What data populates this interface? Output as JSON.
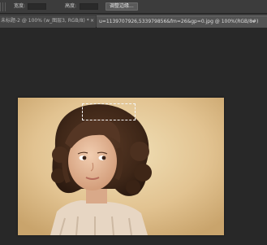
{
  "options_bar": {
    "width_label": "宽度:",
    "height_label": "高度:",
    "refine_edge_button": "调整边缘..."
  },
  "tabs": [
    {
      "label": "未标题-2 @ 100% (w_图层3, RGB/8) *",
      "active": false
    },
    {
      "label": "u=1139707926,533979856&fm=26&gp=0.jpg @ 100%(RGB/8#)",
      "active": true
    }
  ],
  "close_glyph": "×",
  "colors": {
    "workspace_bg": "#282828",
    "toolbar_bg": "#3c3c3c",
    "active_tab_bg": "#535353",
    "photo_tone": "#e3c594"
  }
}
